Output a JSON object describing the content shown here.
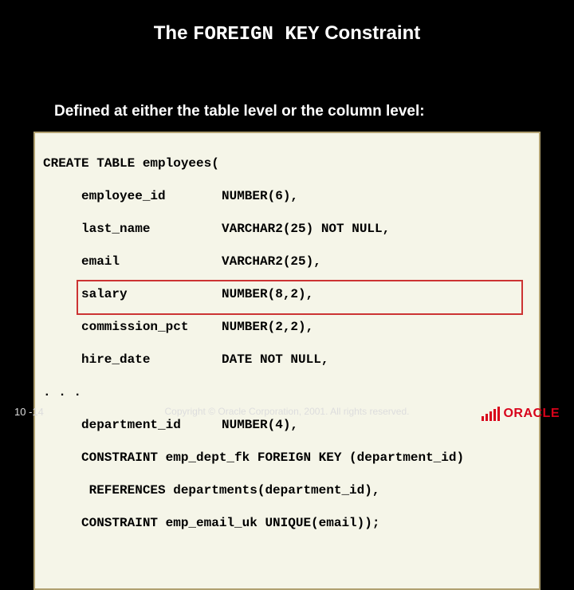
{
  "title": {
    "pre": "The ",
    "kw": "FOREIGN KEY",
    "post": " Constraint"
  },
  "subtitle": "Defined at either the table level or the column level:",
  "code": {
    "l0": "CREATE TABLE employees(",
    "c1a": "employee_id",
    "c1b": "NUMBER(6),",
    "c2a": "last_name",
    "c2b": "VARCHAR2(25) NOT NULL,",
    "c3a": "email",
    "c3b": "VARCHAR2(25),",
    "c4a": "salary",
    "c4b": "NUMBER(8,2),",
    "c5a": "commission_pct",
    "c5b": "NUMBER(2,2),",
    "c6a": "hire_date",
    "c6b": "DATE NOT NULL,",
    "dots": ". . .",
    "c7a": "department_id",
    "c7b": "NUMBER(4),",
    "fk1": "CONSTRAINT emp_dept_fk FOREIGN KEY (department_id)",
    "fk2": " REFERENCES departments(department_id),",
    "uk": "CONSTRAINT emp_email_uk UNIQUE(email));"
  },
  "footer": {
    "slide_num": "10 -14",
    "copyright": "Copyright © Oracle Corporation, 2001. All rights reserved.",
    "logo_text": "ORACLE"
  }
}
